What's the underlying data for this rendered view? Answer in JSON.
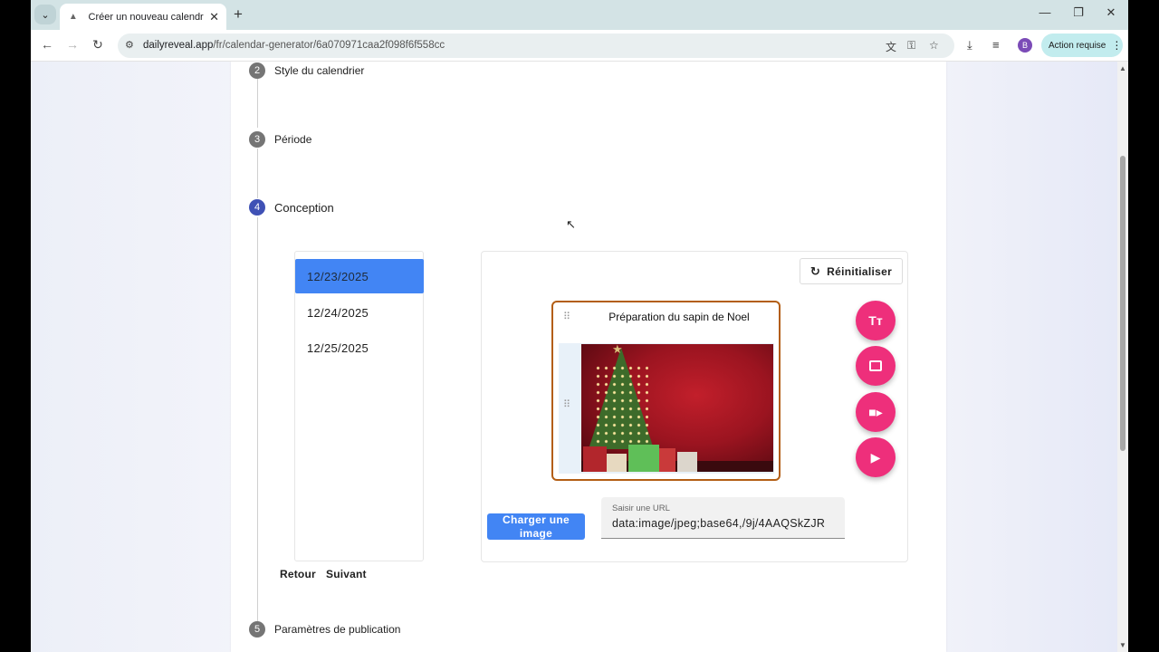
{
  "browser": {
    "tab_title": "Créer un nouveau calendrier nu",
    "url_domain": "dailyreveal.app",
    "url_path": "/fr/calendar-generator/6a070971caa2f098f6f558cc",
    "profile_initial": "B",
    "action_label": "Action requise"
  },
  "stepper": {
    "step2": {
      "number": "2",
      "label": "Style du calendrier"
    },
    "step3": {
      "number": "3",
      "label": "Période"
    },
    "step4": {
      "number": "4",
      "label": "Conception"
    },
    "step5": {
      "number": "5",
      "label": "Paramètres de publication"
    }
  },
  "dates": {
    "items": [
      "12/23/2025",
      "12/24/2025",
      "12/25/2025"
    ],
    "selected_index": 0
  },
  "navigation": {
    "back_label": "Retour",
    "next_label": "Suivant"
  },
  "editor": {
    "reset_label": "Réinitialiser",
    "preview_title": "Préparation du sapin de Noel",
    "upload_label": "Charger une image",
    "url_field_label": "Saisir une URL",
    "url_field_value": "data:image/jpeg;base64,/9j/4AAQSkZJR"
  },
  "icons": {
    "text_fab": "text-fields-icon",
    "image_fab": "image-icon",
    "video_fab": "videocam-icon",
    "youtube_fab": "youtube-icon"
  },
  "colors": {
    "accent_pink": "#ee2f7b",
    "selected_blue": "#4285f4",
    "active_step": "#3f51b5",
    "preview_border": "#b35e14"
  }
}
